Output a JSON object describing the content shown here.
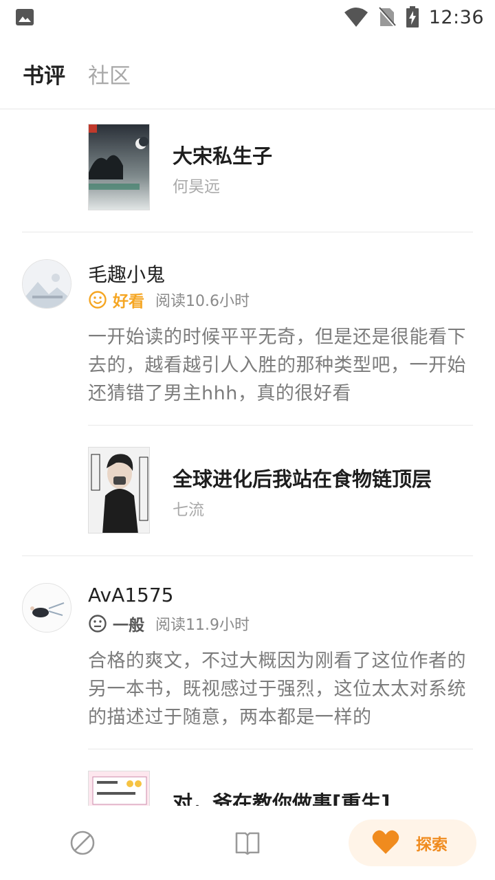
{
  "status_bar": {
    "time": "12:36"
  },
  "header": {
    "tabs": [
      {
        "label": "书评",
        "active": true
      },
      {
        "label": "社区",
        "active": false
      }
    ]
  },
  "feed": {
    "book_1": {
      "title": "大宋私生子",
      "author": "何昊远"
    },
    "review_1": {
      "user": "毛趣小鬼",
      "rating": "好看",
      "reading": "阅读10.6小时",
      "text": "一开始读的时候平平无奇，但是还是很能看下去的，越看越引人入胜的那种类型吧，一开始还猜错了男主hhh，真的很好看"
    },
    "book_2": {
      "title": "全球进化后我站在食物链顶层",
      "author": "七流"
    },
    "review_2": {
      "user": "AvA1575",
      "rating": "一般",
      "reading": "阅读11.9小时",
      "text": "合格的爽文，不过大概因为刚看了这位作者的另一本书，既视感过于强烈，这位太太对系统的描述过于随意，两本都是一样的"
    },
    "book_3": {
      "title": "对，爷在教你做事[重生]"
    }
  },
  "bottom_nav": {
    "explore_label": "探索"
  },
  "colors": {
    "accent": "#f08b1e",
    "rating_good": "#f5a623",
    "rating_neutral": "#555555"
  },
  "icons": [
    "gallery-icon",
    "wifi-icon",
    "no-sim-icon",
    "battery-charging-icon",
    "smile-icon",
    "neutral-face-icon",
    "compass-icon",
    "book-icon",
    "heart-icon"
  ]
}
